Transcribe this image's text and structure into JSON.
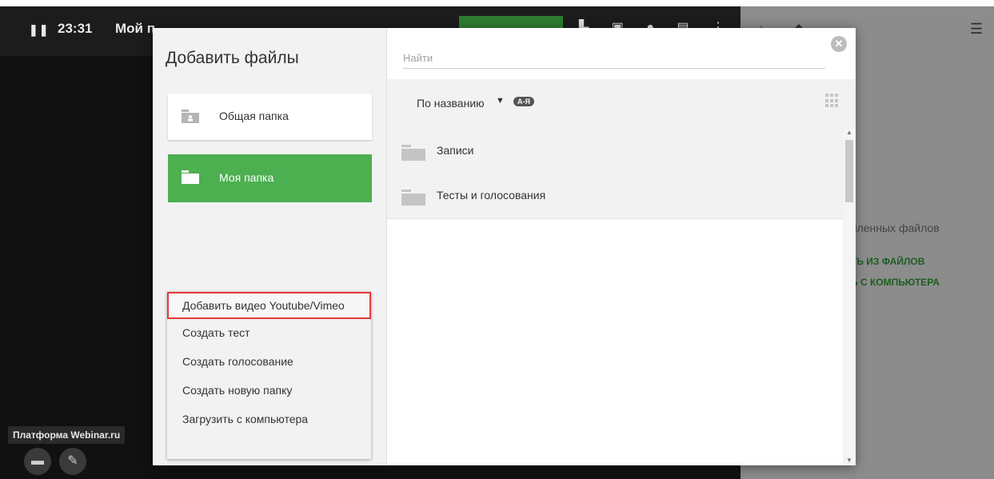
{
  "background": {
    "pause_icon": "pause-icon",
    "time": "23:31",
    "webinar_title": "Мой п",
    "platform_badge": "Платформа Webinar.ru",
    "right_panel": {
      "text": "пленных файлов",
      "link1": "ТЬ ИЗ ФАЙЛОВ",
      "link2": "Ь С КОМПЬЮТЕРА"
    }
  },
  "modal": {
    "title": "Добавить файлы",
    "folders": [
      {
        "label": "Общая папка",
        "icon": "shared-folder-icon",
        "selected": false
      },
      {
        "label": "Моя папка",
        "icon": "folder-icon",
        "selected": true
      }
    ],
    "menu": [
      {
        "label": "Добавить видео Youtube/Vimeo",
        "highlighted": true
      },
      {
        "label": "Создать тест"
      },
      {
        "label": "Создать голосование"
      },
      {
        "label": "Создать новую папку"
      },
      {
        "label": "Загрузить с компьютера"
      }
    ],
    "search": {
      "placeholder": "Найти",
      "value": ""
    },
    "sort": {
      "label": "По названию",
      "order_badge": "А-Я"
    },
    "files": [
      {
        "label": "Записи",
        "icon": "folder-icon"
      },
      {
        "label": "Тесты и голосования",
        "icon": "folder-icon"
      }
    ]
  },
  "colors": {
    "accent_green": "#4caf50",
    "highlight_border": "#e53935"
  }
}
